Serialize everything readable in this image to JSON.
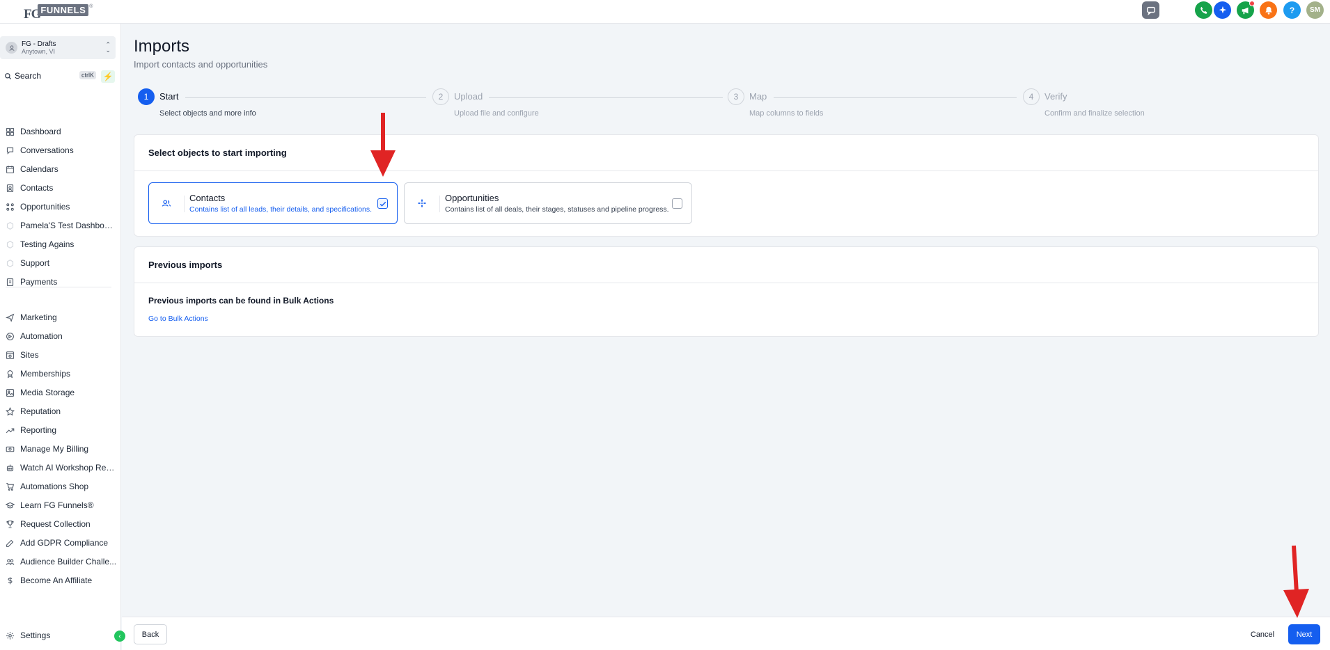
{
  "brand": {
    "logo_fg": "FG",
    "logo_funnels": "FUNNELS",
    "logo_reg": "®"
  },
  "topbar": {
    "icons": [
      {
        "name": "chat-icon",
        "color": "#6b7280"
      },
      {
        "name": "phone-icon",
        "color": "#16a34a"
      },
      {
        "name": "sparkle-icon",
        "color": "#155eef"
      },
      {
        "name": "megaphone-icon",
        "color": "#16a34a"
      },
      {
        "name": "bell-icon",
        "color": "#f97316"
      },
      {
        "name": "help-icon",
        "color": "#1d9bf0",
        "label": "?"
      },
      {
        "name": "user-avatar",
        "color": "#a3b18a",
        "label": "SM"
      }
    ]
  },
  "sidebar": {
    "account": {
      "name": "FG - Drafts",
      "location": "Anytown, VI"
    },
    "search": {
      "label": "Search",
      "shortcut": "ctrlK"
    },
    "items": [
      {
        "label": "Dashboard",
        "icon": "dashboard-icon"
      },
      {
        "label": "Conversations",
        "icon": "chat-bubble-icon"
      },
      {
        "label": "Calendars",
        "icon": "calendar-icon"
      },
      {
        "label": "Contacts",
        "icon": "contacts-icon"
      },
      {
        "label": "Opportunities",
        "icon": "opportunities-icon"
      },
      {
        "label": "Pamela'S Test Dashboard...",
        "icon": "custom-link-icon"
      },
      {
        "label": "Testing Agains",
        "icon": "custom-link-icon"
      },
      {
        "label": "Support",
        "icon": "custom-link-icon"
      },
      {
        "label": "Payments",
        "icon": "payments-icon"
      },
      {
        "label": "Marketing",
        "icon": "send-icon"
      },
      {
        "label": "Automation",
        "icon": "automation-icon"
      },
      {
        "label": "Sites",
        "icon": "sites-icon"
      },
      {
        "label": "Memberships",
        "icon": "membership-icon"
      },
      {
        "label": "Media Storage",
        "icon": "media-icon"
      },
      {
        "label": "Reputation",
        "icon": "star-icon"
      },
      {
        "label": "Reporting",
        "icon": "trend-icon"
      },
      {
        "label": "Manage My Billing",
        "icon": "billing-icon"
      },
      {
        "label": "Watch AI Workshop Repl...",
        "icon": "robot-icon"
      },
      {
        "label": "Automations Shop",
        "icon": "cart-icon"
      },
      {
        "label": "Learn FG Funnels®",
        "icon": "graduation-icon"
      },
      {
        "label": "Request Collection",
        "icon": "trophy-icon"
      },
      {
        "label": "Add GDPR Compliance",
        "icon": "edit-icon"
      },
      {
        "label": "Audience Builder Challe...",
        "icon": "users-icon"
      },
      {
        "label": "Become An Affiliate",
        "icon": "dollar-icon"
      }
    ],
    "settings": "Settings"
  },
  "page": {
    "title": "Imports",
    "subtitle": "Import contacts and opportunities"
  },
  "steps": [
    {
      "num": "1",
      "label": "Start",
      "desc": "Select objects and more info",
      "active": true
    },
    {
      "num": "2",
      "label": "Upload",
      "desc": "Upload file and configure",
      "active": false
    },
    {
      "num": "3",
      "label": "Map",
      "desc": "Map columns to fields",
      "active": false
    },
    {
      "num": "4",
      "label": "Verify",
      "desc": "Confirm and finalize selection",
      "active": false
    }
  ],
  "select_card": {
    "heading": "Select objects to start importing",
    "options": [
      {
        "title": "Contacts",
        "desc": "Contains list of all leads, their details, and specifications.",
        "checked": true
      },
      {
        "title": "Opportunities",
        "desc": "Contains list of all deals, their stages, statuses and pipeline progress.",
        "checked": false
      }
    ]
  },
  "previous_card": {
    "heading": "Previous imports",
    "text": "Previous imports can be found in Bulk Actions",
    "link": "Go to Bulk Actions"
  },
  "footer": {
    "back": "Back",
    "cancel": "Cancel",
    "next": "Next"
  },
  "colors": {
    "primary": "#155eef",
    "annotation_arrow": "#e02424"
  }
}
